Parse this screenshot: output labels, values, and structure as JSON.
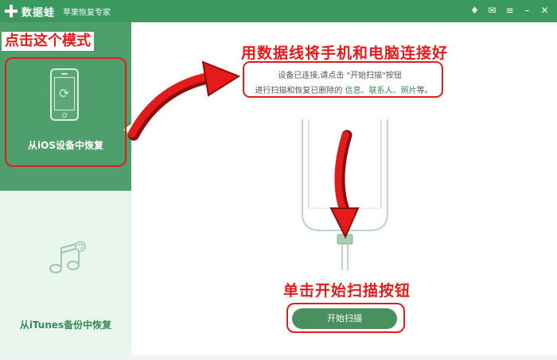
{
  "titlebar": {
    "app_name": "数据蛙",
    "subtitle": "苹果恢复专家",
    "icons": [
      "diamond-icon",
      "feedback-icon",
      "menu-icon",
      "minimize-icon",
      "close-icon"
    ]
  },
  "sidebar": {
    "ios_mode_label": "从iOS设备中恢复",
    "itunes_mode_label": "从iTunes备份中恢复"
  },
  "annotations": {
    "click_mode": "点击这个模式",
    "connect_phone": "用数据线将手机和电脑连接好",
    "click_scan": "单击开始扫描按钮"
  },
  "main": {
    "status_line1": "设备已连接,请点击 \"开始扫描\"按钮",
    "status_line2_prefix": "进行扫描和恢复已删除的 ",
    "status_line2_highlight": "信息、联系人、照片",
    "status_line2_suffix": "等。",
    "scan_button_label": "开始扫描"
  },
  "colors": {
    "accent_green": "#3a9a5e",
    "annotation_red": "#e41b1b"
  }
}
